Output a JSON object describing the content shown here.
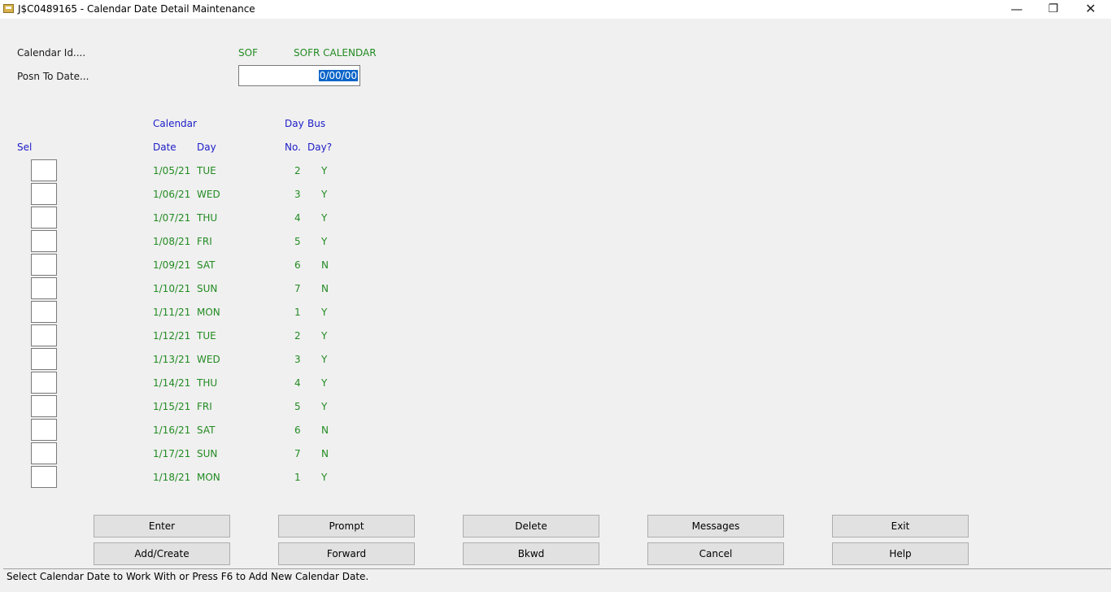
{
  "window": {
    "title": "J$C0489165 - Calendar Date Detail Maintenance",
    "minimize": "—",
    "restore": "❐",
    "close": "✕"
  },
  "header": {
    "calendar_id_label": "Calendar Id....",
    "calendar_id_value": "SOF",
    "calendar_name": "SOFR CALENDAR",
    "posn_label": "Posn To Date...",
    "posn_value": "0/00/00"
  },
  "columns": {
    "sel": "Sel",
    "calendar": "Calendar",
    "date": "Date",
    "day": "Day",
    "day_top": "Day",
    "day_no": "No.",
    "bus_top": "Bus",
    "bus_day": "Day?"
  },
  "rows": [
    {
      "date": "1/05/21",
      "day": "TUE",
      "no": "2",
      "bus": "Y"
    },
    {
      "date": "1/06/21",
      "day": "WED",
      "no": "3",
      "bus": "Y"
    },
    {
      "date": "1/07/21",
      "day": "THU",
      "no": "4",
      "bus": "Y"
    },
    {
      "date": "1/08/21",
      "day": "FRI",
      "no": "5",
      "bus": "Y"
    },
    {
      "date": "1/09/21",
      "day": "SAT",
      "no": "6",
      "bus": "N"
    },
    {
      "date": "1/10/21",
      "day": "SUN",
      "no": "7",
      "bus": "N"
    },
    {
      "date": "1/11/21",
      "day": "MON",
      "no": "1",
      "bus": "Y"
    },
    {
      "date": "1/12/21",
      "day": "TUE",
      "no": "2",
      "bus": "Y"
    },
    {
      "date": "1/13/21",
      "day": "WED",
      "no": "3",
      "bus": "Y"
    },
    {
      "date": "1/14/21",
      "day": "THU",
      "no": "4",
      "bus": "Y"
    },
    {
      "date": "1/15/21",
      "day": "FRI",
      "no": "5",
      "bus": "Y"
    },
    {
      "date": "1/16/21",
      "day": "SAT",
      "no": "6",
      "bus": "N"
    },
    {
      "date": "1/17/21",
      "day": "SUN",
      "no": "7",
      "bus": "N"
    },
    {
      "date": "1/18/21",
      "day": "MON",
      "no": "1",
      "bus": "Y"
    }
  ],
  "buttons": {
    "enter": "Enter",
    "prompt": "Prompt",
    "delete": "Delete",
    "messages": "Messages",
    "exit": "Exit",
    "add_create": "Add/Create",
    "forward": "Forward",
    "bkwd": "Bkwd",
    "cancel": "Cancel",
    "help": "Help"
  },
  "status": "Select Calendar Date to Work With or Press F6 to Add New Calendar Date."
}
